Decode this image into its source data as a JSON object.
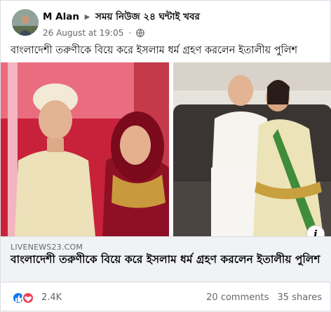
{
  "post": {
    "author": "M Alan",
    "group": "সময় নিউজ ২৪ ঘন্টাই খবর",
    "timestamp": "26 August at 19:05",
    "separator": "·",
    "caption": "বাংলাদেশী তরুণীকে বিয়ে করে ইসলাম ধর্ম গ্রহণ করলেন ইতালীয় পুলিশ"
  },
  "link": {
    "domain": "LIVENEWS23.COM",
    "title": "বাংলাদেশী তরুণীকে বিয়ে করে ইসলাম ধর্ম গ্রহণ করলেন ইতালীয় পুলিশ",
    "info_icon": "i"
  },
  "stats": {
    "reactions": "2.4K",
    "comments": "20 comments",
    "shares": "35 shares"
  },
  "icons": {
    "arrow": "▶",
    "privacy": "globe-icon",
    "like": "like-icon",
    "love": "love-icon"
  },
  "colors": {
    "like": "#1877f2",
    "love": "#f33e58",
    "muted_text": "#65676b"
  }
}
